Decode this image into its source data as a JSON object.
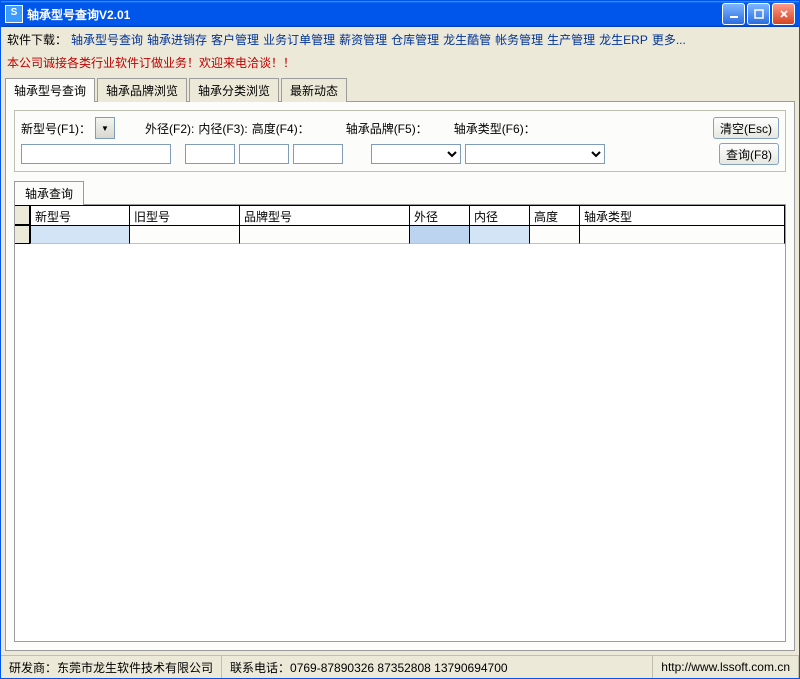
{
  "title": "轴承型号查询V2.01",
  "menu_lead": "软件下载：",
  "menu": [
    "轴承型号查询",
    "轴承进销存",
    "客户管理",
    "业务订单管理",
    "薪资管理",
    "仓库管理",
    "龙生酷管",
    "帐务管理",
    "生产管理",
    "龙生ERP",
    "更多..."
  ],
  "banner": "本公司诚接各类行业软件订做业务！欢迎来电洽谈！！",
  "outer_tabs": [
    "轴承型号查询",
    "轴承品牌浏览",
    "轴承分类浏览",
    "最新动态"
  ],
  "filter": {
    "f1_label": "新型号(F1)：",
    "f2_label": "外径(F2):",
    "f3_label": "内径(F3):",
    "f4_label": "高度(F4)：",
    "f5_label": "轴承品牌(F5)：",
    "f6_label": "轴承类型(F6)：",
    "f1_value": "",
    "f2_value": "",
    "f3_value": "",
    "f4_value": "",
    "f5_value": "",
    "f6_value": ""
  },
  "buttons": {
    "clear": "清空(Esc)",
    "search": "查询(F8)"
  },
  "inner_tab": "轴承查询",
  "columns": [
    "新型号",
    "旧型号",
    "品牌型号",
    "外径",
    "内径",
    "高度",
    "轴承类型"
  ],
  "status": {
    "vendor": "研发商：东莞市龙生软件技术有限公司",
    "phone": "联系电话：0769-87890326 87352808 13790694700",
    "url": "http://www.lssoft.com.cn"
  }
}
